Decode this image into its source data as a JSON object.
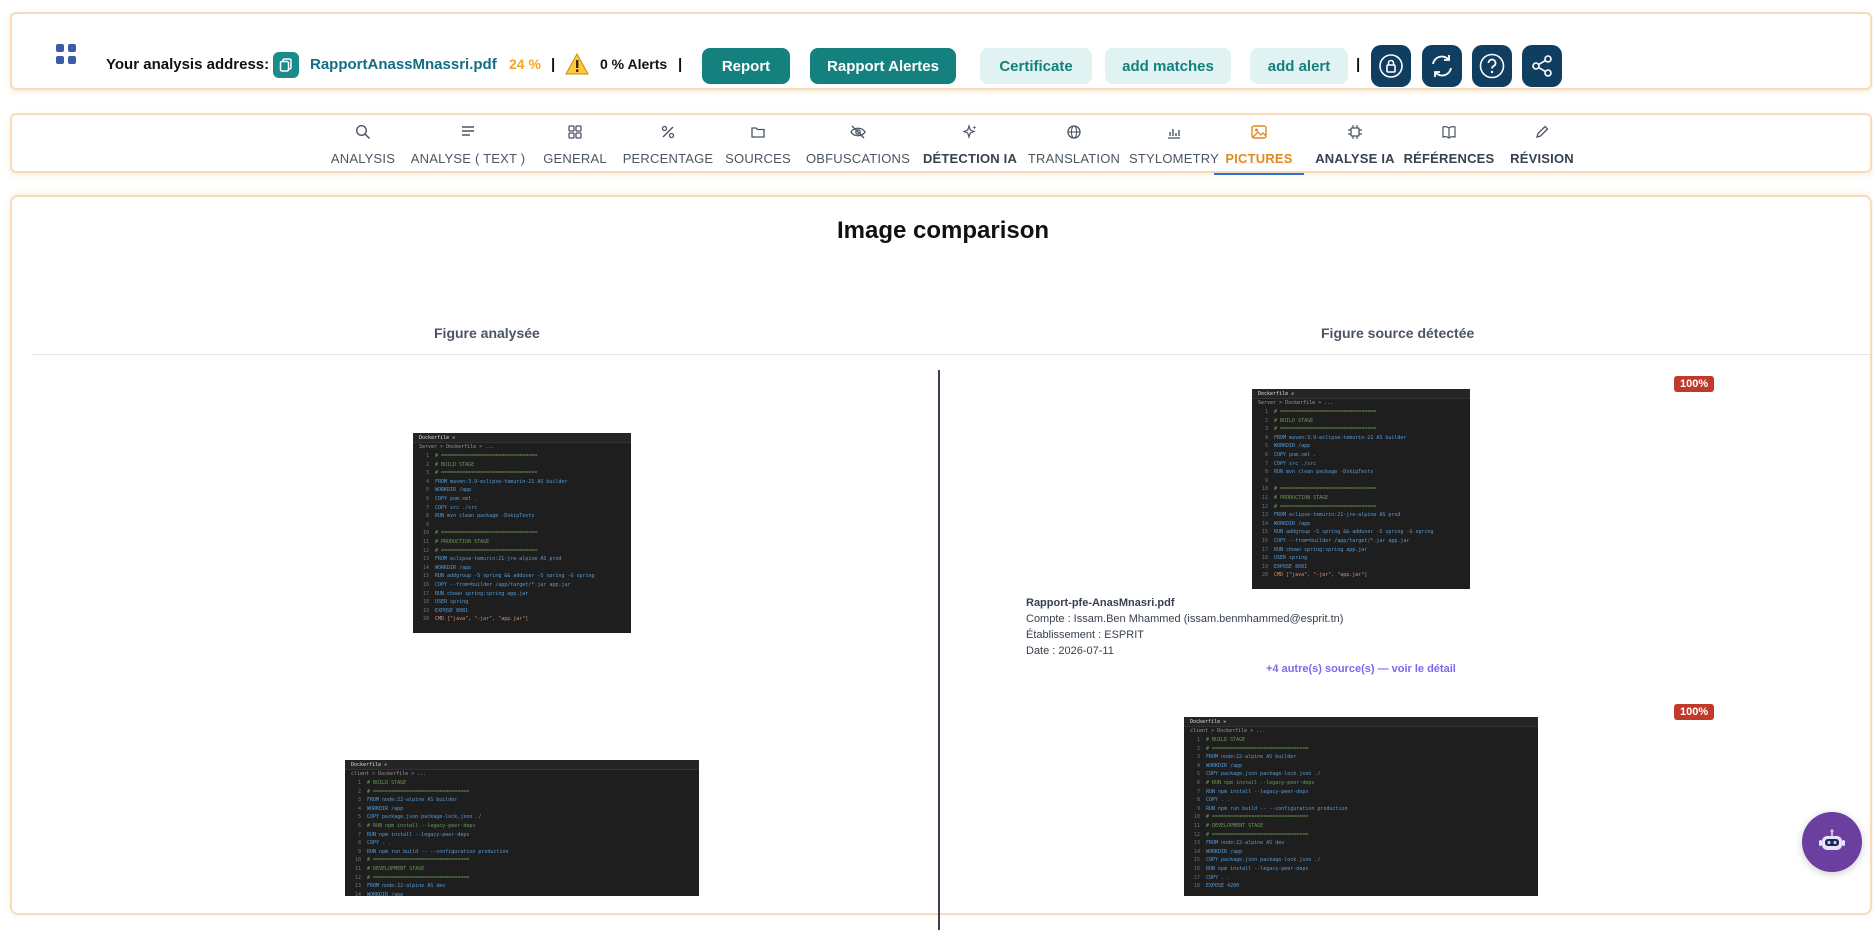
{
  "header": {
    "analysis_label": "Your analysis address:",
    "file_name": "RapportAnassMnassri.pdf",
    "percent": "24 %",
    "separator": "|",
    "alerts": "0 % Alerts",
    "buttons": {
      "report": "Report",
      "rapport_alertes": "Rapport Alertes",
      "certificate": "Certificate",
      "add_matches": "add matches",
      "add_alert": "add alert"
    },
    "icons": [
      "apps-grid-icon",
      "copy-file-icon",
      "warning-icon",
      "lock-icon",
      "refresh-icon",
      "help-icon",
      "share-icon"
    ],
    "colors": {
      "primary": "#15817f",
      "light_button": "#e0f2f1",
      "percent": "#f5a623",
      "round_button": "#0f3e60"
    }
  },
  "tabs": [
    {
      "label": "ANALYSIS",
      "icon": "search-icon"
    },
    {
      "label": "ANALYSE ( TEXT )",
      "icon": "text-lines-icon"
    },
    {
      "label": "GENERAL",
      "icon": "grid-icon"
    },
    {
      "label": "PERCENTAGE",
      "icon": "percent-icon"
    },
    {
      "label": "SOURCES",
      "icon": "folder-icon"
    },
    {
      "label": "OBFUSCATIONS",
      "icon": "eye-off-icon"
    },
    {
      "label": "DÉTECTION IA",
      "icon": "sparkles-icon"
    },
    {
      "label": "TRANSLATION",
      "icon": "globe-icon"
    },
    {
      "label": "STYLOMETRY",
      "icon": "bar-chart-icon"
    },
    {
      "label": "PICTURES",
      "icon": "image-icon",
      "active": true
    },
    {
      "label": "ANALYSE IA",
      "icon": "chip-icon"
    },
    {
      "label": "RÉFÉRENCES",
      "icon": "book-icon"
    },
    {
      "label": "RÉVISION",
      "icon": "pencil-icon"
    }
  ],
  "comparison": {
    "title": "Image comparison",
    "left_header": "Figure analysée",
    "right_header": "Figure source détectée",
    "matches": [
      {
        "badge": "100%",
        "source_title": "Rapport-pfe-AnasMnasri.pdf",
        "account": "Compte : Issam.Ben Mhammed (issam.benmhammed@esprit.tn)",
        "institution": "Établissement : ESPRIT",
        "date": "Date : 2026-07-11",
        "more_sources": "+4 autre(s) source(s) — voir le détail"
      },
      {
        "badge": "100%"
      }
    ]
  },
  "code_snippet": {
    "tab": "Dockerfile ✕",
    "crumb": "Server > Dockerfile > ...",
    "lines": [
      [
        "1",
        "c",
        "# ================================"
      ],
      [
        "2",
        "c",
        "# BUILD STAGE"
      ],
      [
        "3",
        "c",
        "# ================================"
      ],
      [
        "4",
        "k",
        "FROM maven:3.9-eclipse-temurin-21 AS builder"
      ],
      [
        "5",
        "k",
        "WORKDIR /app"
      ],
      [
        "6",
        "k",
        "COPY pom.xml ."
      ],
      [
        "7",
        "k",
        "COPY src ./src"
      ],
      [
        "8",
        "k",
        "RUN mvn clean package -DskipTests"
      ],
      [
        "9",
        "t",
        ""
      ],
      [
        "10",
        "c",
        "# ================================"
      ],
      [
        "11",
        "c",
        "# PRODUCTION STAGE"
      ],
      [
        "12",
        "c",
        "# ================================"
      ],
      [
        "13",
        "k",
        "FROM eclipse-temurin:21-jre-alpine AS prod"
      ],
      [
        "14",
        "k",
        "WORKDIR /app"
      ],
      [
        "15",
        "k",
        "RUN addgroup -S spring && adduser -S spring -G spring"
      ],
      [
        "16",
        "k",
        "COPY --from=builder /app/target/*.jar app.jar"
      ],
      [
        "17",
        "k",
        "RUN chown spring:spring app.jar"
      ],
      [
        "18",
        "k",
        "USER spring"
      ],
      [
        "19",
        "k",
        "EXPOSE 8081"
      ],
      [
        "20",
        "s",
        "CMD [\"java\", \"-jar\", \"app.jar\"]"
      ]
    ]
  },
  "code_snippet_2": {
    "tab": "Dockerfile ✕",
    "crumb": "client > Dockerfile > ...",
    "lines": [
      [
        "1",
        "c",
        "# BUILD STAGE"
      ],
      [
        "2",
        "c",
        "# ================================"
      ],
      [
        "3",
        "k",
        "FROM node:22-alpine AS builder"
      ],
      [
        "4",
        "k",
        "WORKDIR /app"
      ],
      [
        "5",
        "k",
        "COPY package.json package-lock.json ./"
      ],
      [
        "6",
        "c",
        "# RUN npm install --legacy-peer-deps"
      ],
      [
        "7",
        "k",
        "RUN npm install --legacy-peer-deps"
      ],
      [
        "8",
        "k",
        "COPY . ."
      ],
      [
        "9",
        "k",
        "RUN npm run build -- --configuration production"
      ],
      [
        "10",
        "c",
        "# ================================"
      ],
      [
        "11",
        "c",
        "# DEVELOPMENT STAGE"
      ],
      [
        "12",
        "c",
        "# ================================"
      ],
      [
        "13",
        "k",
        "FROM node:22-alpine AS dev"
      ],
      [
        "14",
        "k",
        "WORKDIR /app"
      ],
      [
        "15",
        "k",
        "COPY package.json package-lock.json ./"
      ],
      [
        "16",
        "k",
        "RUN npm install --legacy-peer-deps"
      ],
      [
        "17",
        "k",
        "COPY . ."
      ],
      [
        "18",
        "k",
        "EXPOSE 4200"
      ]
    ]
  }
}
